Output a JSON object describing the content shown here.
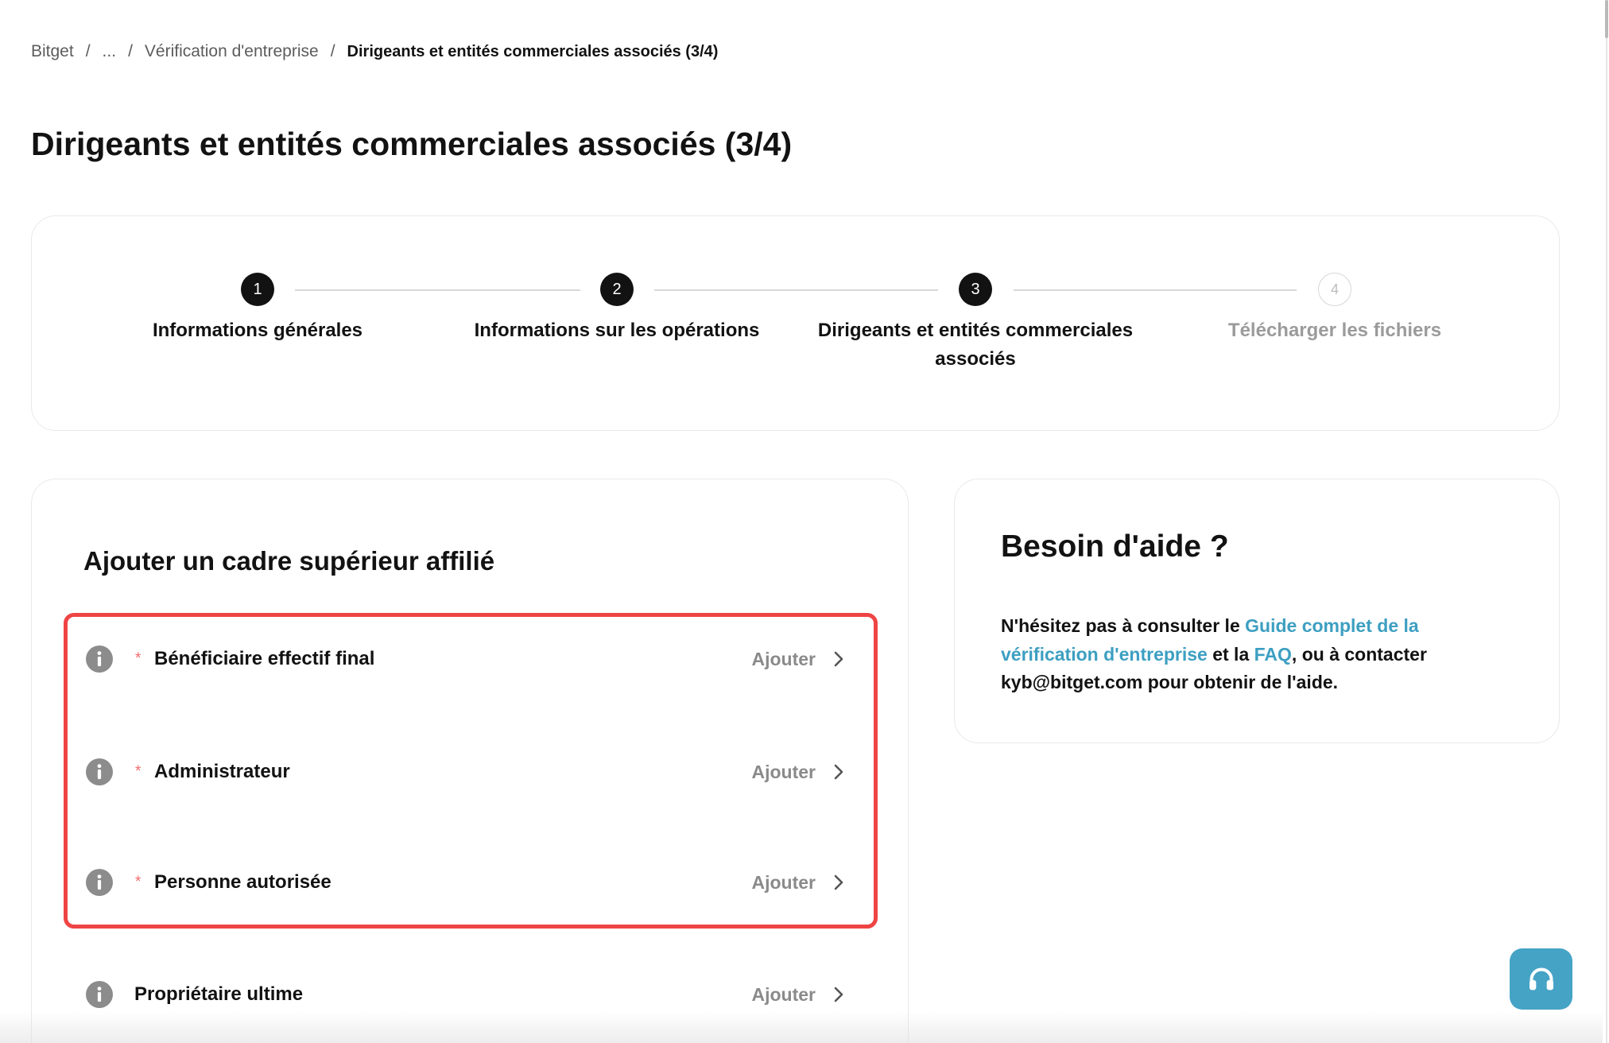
{
  "breadcrumb": {
    "items": [
      {
        "label": "Bitget"
      },
      {
        "label": "..."
      },
      {
        "label": "Vérification d'entreprise"
      }
    ],
    "separator": "/",
    "current": "Dirigeants et entités commerciales associés (3/4)"
  },
  "page_title": "Dirigeants et entités commerciales associés (3/4)",
  "stepper": {
    "steps": [
      {
        "number": "1",
        "label": "Informations générales",
        "active": true
      },
      {
        "number": "2",
        "label": "Informations sur les opérations",
        "active": true
      },
      {
        "number": "3",
        "label": "Dirigeants et entités commerciales associés",
        "active": true
      },
      {
        "number": "4",
        "label": "Télécharger les fichiers",
        "active": false
      }
    ]
  },
  "executives": {
    "title": "Ajouter un cadre supérieur affilié",
    "rows": [
      {
        "icon": "info-icon",
        "required_mark": "*",
        "label": "Bénéficiaire effectif final",
        "action": "Ajouter",
        "action_icon": "chevron-right-icon"
      },
      {
        "icon": "info-icon",
        "required_mark": "*",
        "label": "Administrateur",
        "action": "Ajouter",
        "action_icon": "chevron-right-icon"
      },
      {
        "icon": "info-icon",
        "required_mark": "*",
        "label": "Personne autorisée",
        "action": "Ajouter",
        "action_icon": "chevron-right-icon"
      },
      {
        "icon": "info-icon",
        "label": "Propriétaire ultime",
        "action": "Ajouter",
        "action_icon": "chevron-right-icon"
      }
    ]
  },
  "help": {
    "title": "Besoin d'aide ?",
    "text_before": "N'hésitez pas à consulter le ",
    "guide_link": "Guide complet de la vérification d'entreprise",
    "text_middle": " et la ",
    "faq_link": "FAQ",
    "text_after": ", ou à contacter kyb@bitget.com pour obtenir de l'aide."
  },
  "support_button": {
    "icon": "headset-icon"
  },
  "colors": {
    "text": "#121212",
    "muted": "#8a8a8a",
    "link": "#3d9fc1",
    "highlight": "#ef4444",
    "required": "#f26b6b",
    "support": "#45a3c6",
    "step_active": "#121212",
    "step_inactive": "#bdbdbd"
  }
}
